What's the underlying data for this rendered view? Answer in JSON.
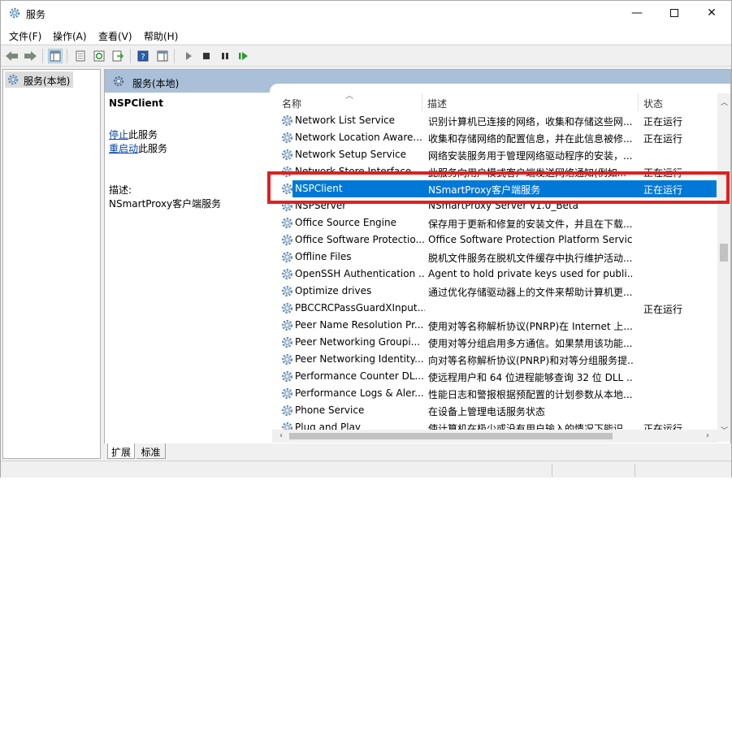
{
  "window": {
    "title": "服务",
    "controls": {
      "minimize": "—",
      "close": "✕"
    }
  },
  "menu": {
    "items": [
      "文件(F)",
      "操作(A)",
      "查看(V)",
      "帮助(H)"
    ]
  },
  "tree": {
    "root_label": "服务(本地)"
  },
  "panel": {
    "header_title": "服务(本地)"
  },
  "details": {
    "service_name": "NSPClient",
    "stop_link": "停止",
    "stop_suffix": "此服务",
    "restart_link": "重启动",
    "restart_suffix": "此服务",
    "desc_label": "描述:",
    "desc_text": "NSmartProxy客户端服务"
  },
  "list": {
    "columns": {
      "name": "名称",
      "description": "描述",
      "status": "状态"
    },
    "rows": [
      {
        "name": "Network List Service",
        "description": "识别计算机已连接的网络，收集和存储这些网...",
        "status": "正在运行"
      },
      {
        "name": "Network Location Aware...",
        "description": "收集和存储网络的配置信息，并在此信息被修...",
        "status": "正在运行"
      },
      {
        "name": "Network Setup Service",
        "description": "网络安装服务用于管理网络驱动程序的安装，...",
        "status": ""
      },
      {
        "name": "Network Store Interface ...",
        "description": "此服务向用户模式客户端发送网络通知(例如...",
        "status": "正在运行"
      },
      {
        "name": "NSPClient",
        "description": "NSmartProxy客户端服务",
        "status": "正在运行"
      },
      {
        "name": "NSPServer",
        "description": "NSmartProxy Server v1.0_Beta",
        "status": ""
      },
      {
        "name": "Office  Source Engine",
        "description": "保存用于更新和修复的安装文件，并且在下载...",
        "status": ""
      },
      {
        "name": "Office Software Protectio...",
        "description": "Office Software Protection Platform Servic...",
        "status": ""
      },
      {
        "name": "Offline Files",
        "description": "脱机文件服务在脱机文件缓存中执行维护活动...",
        "status": ""
      },
      {
        "name": "OpenSSH Authentication ...",
        "description": "Agent to hold private keys used for publi...",
        "status": ""
      },
      {
        "name": "Optimize drives",
        "description": "通过优化存储驱动器上的文件来帮助计算机更...",
        "status": ""
      },
      {
        "name": "PBCCRCPassGuardXInput...",
        "description": "",
        "status": "正在运行"
      },
      {
        "name": "Peer Name Resolution Pr...",
        "description": "使用对等名称解析协议(PNRP)在 Internet 上...",
        "status": ""
      },
      {
        "name": "Peer Networking Groupi...",
        "description": "使用对等分组启用多方通信。如果禁用该功能...",
        "status": ""
      },
      {
        "name": "Peer Networking Identity...",
        "description": "向对等名称解析协议(PNRP)和对等分组服务提...",
        "status": ""
      },
      {
        "name": "Performance Counter DL...",
        "description": "使远程用户和 64 位进程能够查询 32 位 DLL ...",
        "status": ""
      },
      {
        "name": "Performance Logs & Aler...",
        "description": "性能日志和警报根据预配置的计划参数从本地...",
        "status": ""
      },
      {
        "name": "Phone Service",
        "description": "在设备上管理电话服务状态",
        "status": ""
      },
      {
        "name": "Plug and Play",
        "description": "使计算机在极少或没有用户输入的情况下能识...",
        "status": "正在运行"
      }
    ],
    "selected_index": 4
  },
  "tabs": [
    "扩展",
    "标准"
  ],
  "colors": {
    "selection": "#0078d7",
    "header_band": "#a9c0d8",
    "highlight_box": "#e02020"
  }
}
